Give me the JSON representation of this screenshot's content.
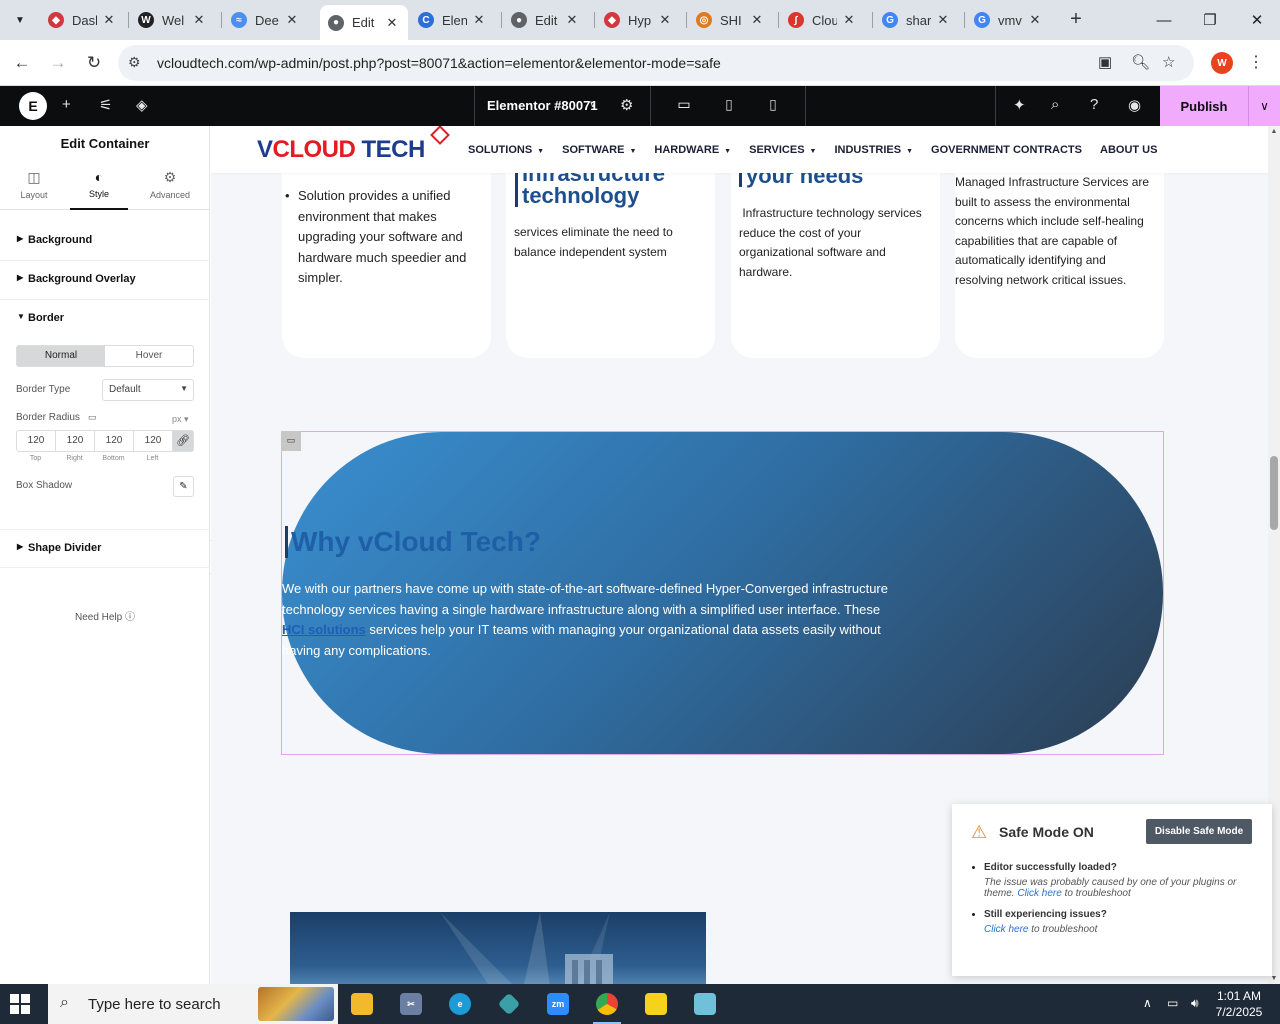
{
  "browser": {
    "tabs": [
      {
        "title": "Dasl",
        "fav_color": "#d3373f",
        "glyph": "◆"
      },
      {
        "title": "Wel",
        "fav_color": "#222222",
        "glyph": "W"
      },
      {
        "title": "Dee",
        "fav_color": "#4b8ff0",
        "glyph": "≈"
      },
      {
        "title": "Edit",
        "fav_color": "#5f6368",
        "glyph": "●"
      },
      {
        "title": "Elen",
        "fav_color": "#2d6fd8",
        "glyph": "C"
      },
      {
        "title": "Edit",
        "fav_color": "#5f6368",
        "glyph": "●"
      },
      {
        "title": "Hyp",
        "fav_color": "#d3373f",
        "glyph": "◆"
      },
      {
        "title": "SHI",
        "fav_color": "#e07a1f",
        "glyph": "◎"
      },
      {
        "title": "Clou",
        "fav_color": "#d9362c",
        "glyph": "∫"
      },
      {
        "title": "shar",
        "fav_color": "#4285f4",
        "glyph": "G"
      },
      {
        "title": "vmv",
        "fav_color": "#4285f4",
        "glyph": "G"
      }
    ],
    "url": "vcloudtech.com/wp-admin/post.php?post=80071&action=elementor&elementor-mode=safe",
    "profile_initial": "W"
  },
  "elementor": {
    "document_name": "Elementor #80071",
    "publish_label": "Publish"
  },
  "panel": {
    "title": "Edit Container",
    "tabs": [
      {
        "label": "Layout",
        "icon": "layout-icon"
      },
      {
        "label": "Style",
        "icon": "style-icon"
      },
      {
        "label": "Advanced",
        "icon": "gear-icon"
      }
    ],
    "sections": {
      "background": "Background",
      "background_overlay": "Background Overlay",
      "border": "Border",
      "shape_divider": "Shape Divider"
    },
    "state_toggle": {
      "normal": "Normal",
      "hover": "Hover"
    },
    "border_type_label": "Border Type",
    "border_type_value": "Default",
    "border_radius_label": "Border Radius",
    "unit": "px",
    "radius_values": {
      "top": "120",
      "right": "120",
      "bottom": "120",
      "left": "120"
    },
    "radius_labels": {
      "top": "Top",
      "right": "Right",
      "bottom": "Bottom",
      "left": "Left"
    },
    "box_shadow_label": "Box Shadow",
    "need_help": "Need Help"
  },
  "site": {
    "logo": {
      "part1": "V",
      "part2": "CLOUD",
      "part3": " TECH"
    },
    "menu": [
      {
        "label": "SOLUTIONS",
        "dropdown": true
      },
      {
        "label": "SOFTWARE",
        "dropdown": true
      },
      {
        "label": "HARDWARE",
        "dropdown": true
      },
      {
        "label": "SERVICES",
        "dropdown": true
      },
      {
        "label": "INDUSTRIES",
        "dropdown": true
      },
      {
        "label": "GOVERNMENT CONTRACTS",
        "dropdown": false
      },
      {
        "label": "ABOUT US",
        "dropdown": false
      }
    ],
    "cards": {
      "c1_text": "Solution provides a unified environment that makes upgrading your software and hardware much speedier and simpler.",
      "c2_heading_a": "Infrastructure",
      "c2_heading_b": "technology",
      "c2_text": "services eliminate the need to balance independent system",
      "c3_heading": "your needs",
      "c3_text": " Infrastructure technology services reduce the cost of your organizational software and hardware.",
      "c4_text": "Managed Infrastructure Services are built to assess the environmental concerns which include self-healing capabilities that are capable of automatically identifying and resolving network critical issues."
    },
    "hero": {
      "title": "Why vCloud Tech?",
      "body_1": "We with our partners have come up with state-of-the-art software-defined Hyper-Converged infrastructure technology services having a single hardware infrastructure along with a simplified user interface. These ",
      "link": "HCI solutions",
      "body_2": " services help your IT teams with managing your organizational data assets easily without having any complications."
    }
  },
  "safe_mode": {
    "title": "Safe Mode ON",
    "button": "Disable Safe Mode",
    "item1_title": "Editor successfully loaded?",
    "item1_text": "The issue was probably caused by one of your plugins or theme.",
    "item1_link": "Click here",
    "item1_tail": " to troubleshoot",
    "item2_title": "Still experiencing issues?",
    "item2_link": "Click here",
    "item2_tail": " to troubleshoot"
  },
  "taskbar": {
    "search_placeholder": "Type here to search",
    "time": "1:01 AM",
    "date": "7/2/2025"
  }
}
